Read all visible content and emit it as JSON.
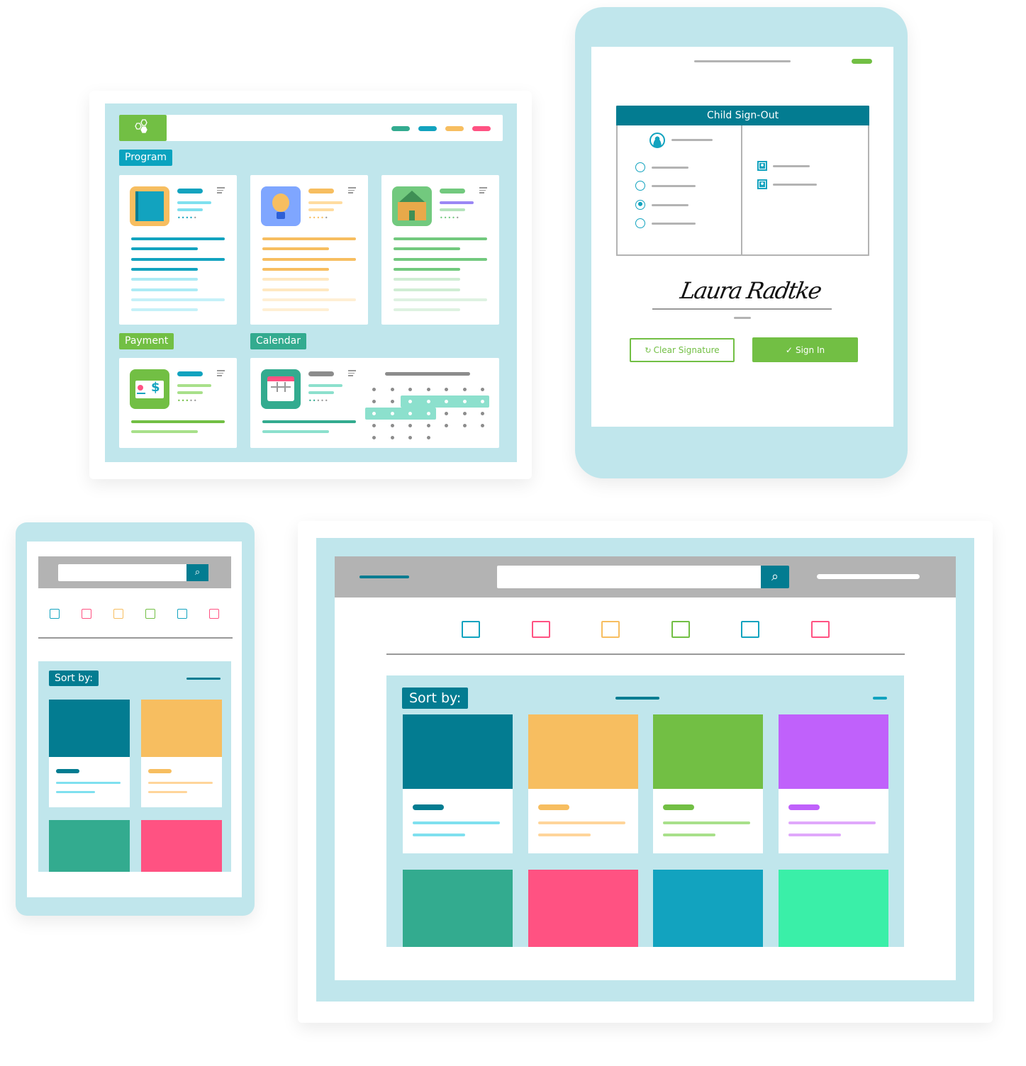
{
  "colors": {
    "light_blue": "#c0e6ec",
    "dark_teal": "#037c91",
    "teal": "#33ab8f",
    "cyan": "#12a3bf",
    "yellow": "#f7be60",
    "pink": "#ff5282",
    "green": "#72bf44",
    "purple": "#c061fb",
    "mint": "#3aefa8",
    "grey": "#b3b3b3"
  },
  "dashboard": {
    "logo_icon": "hexagon-cluster-icon",
    "program_label": "Program",
    "payment_label": "Payment",
    "calendar_label": "Calendar",
    "program_cards": [
      {
        "icon": "book-icon",
        "accent": "#12a3bf",
        "light": "#7fe0ef"
      },
      {
        "icon": "lightbulb-icon",
        "accent": "#f7be60",
        "light": "#ffdca0"
      },
      {
        "icon": "school-house-icon",
        "accent": "#72c97e",
        "light": "#b5e3bc"
      }
    ]
  },
  "signout": {
    "title": "Child Sign-Out",
    "signature": "Laura Radtke",
    "clear_label": "Clear Signature",
    "clear_icon": "refresh-icon",
    "sign_in_label": "Sign In",
    "sign_in_icon": "check-icon",
    "selected_child_index": 2
  },
  "mobile": {
    "sort_label": "Sort by:",
    "search_icon": "search-icon"
  },
  "desktop": {
    "sort_label": "Sort by:",
    "search_icon": "search-icon"
  }
}
